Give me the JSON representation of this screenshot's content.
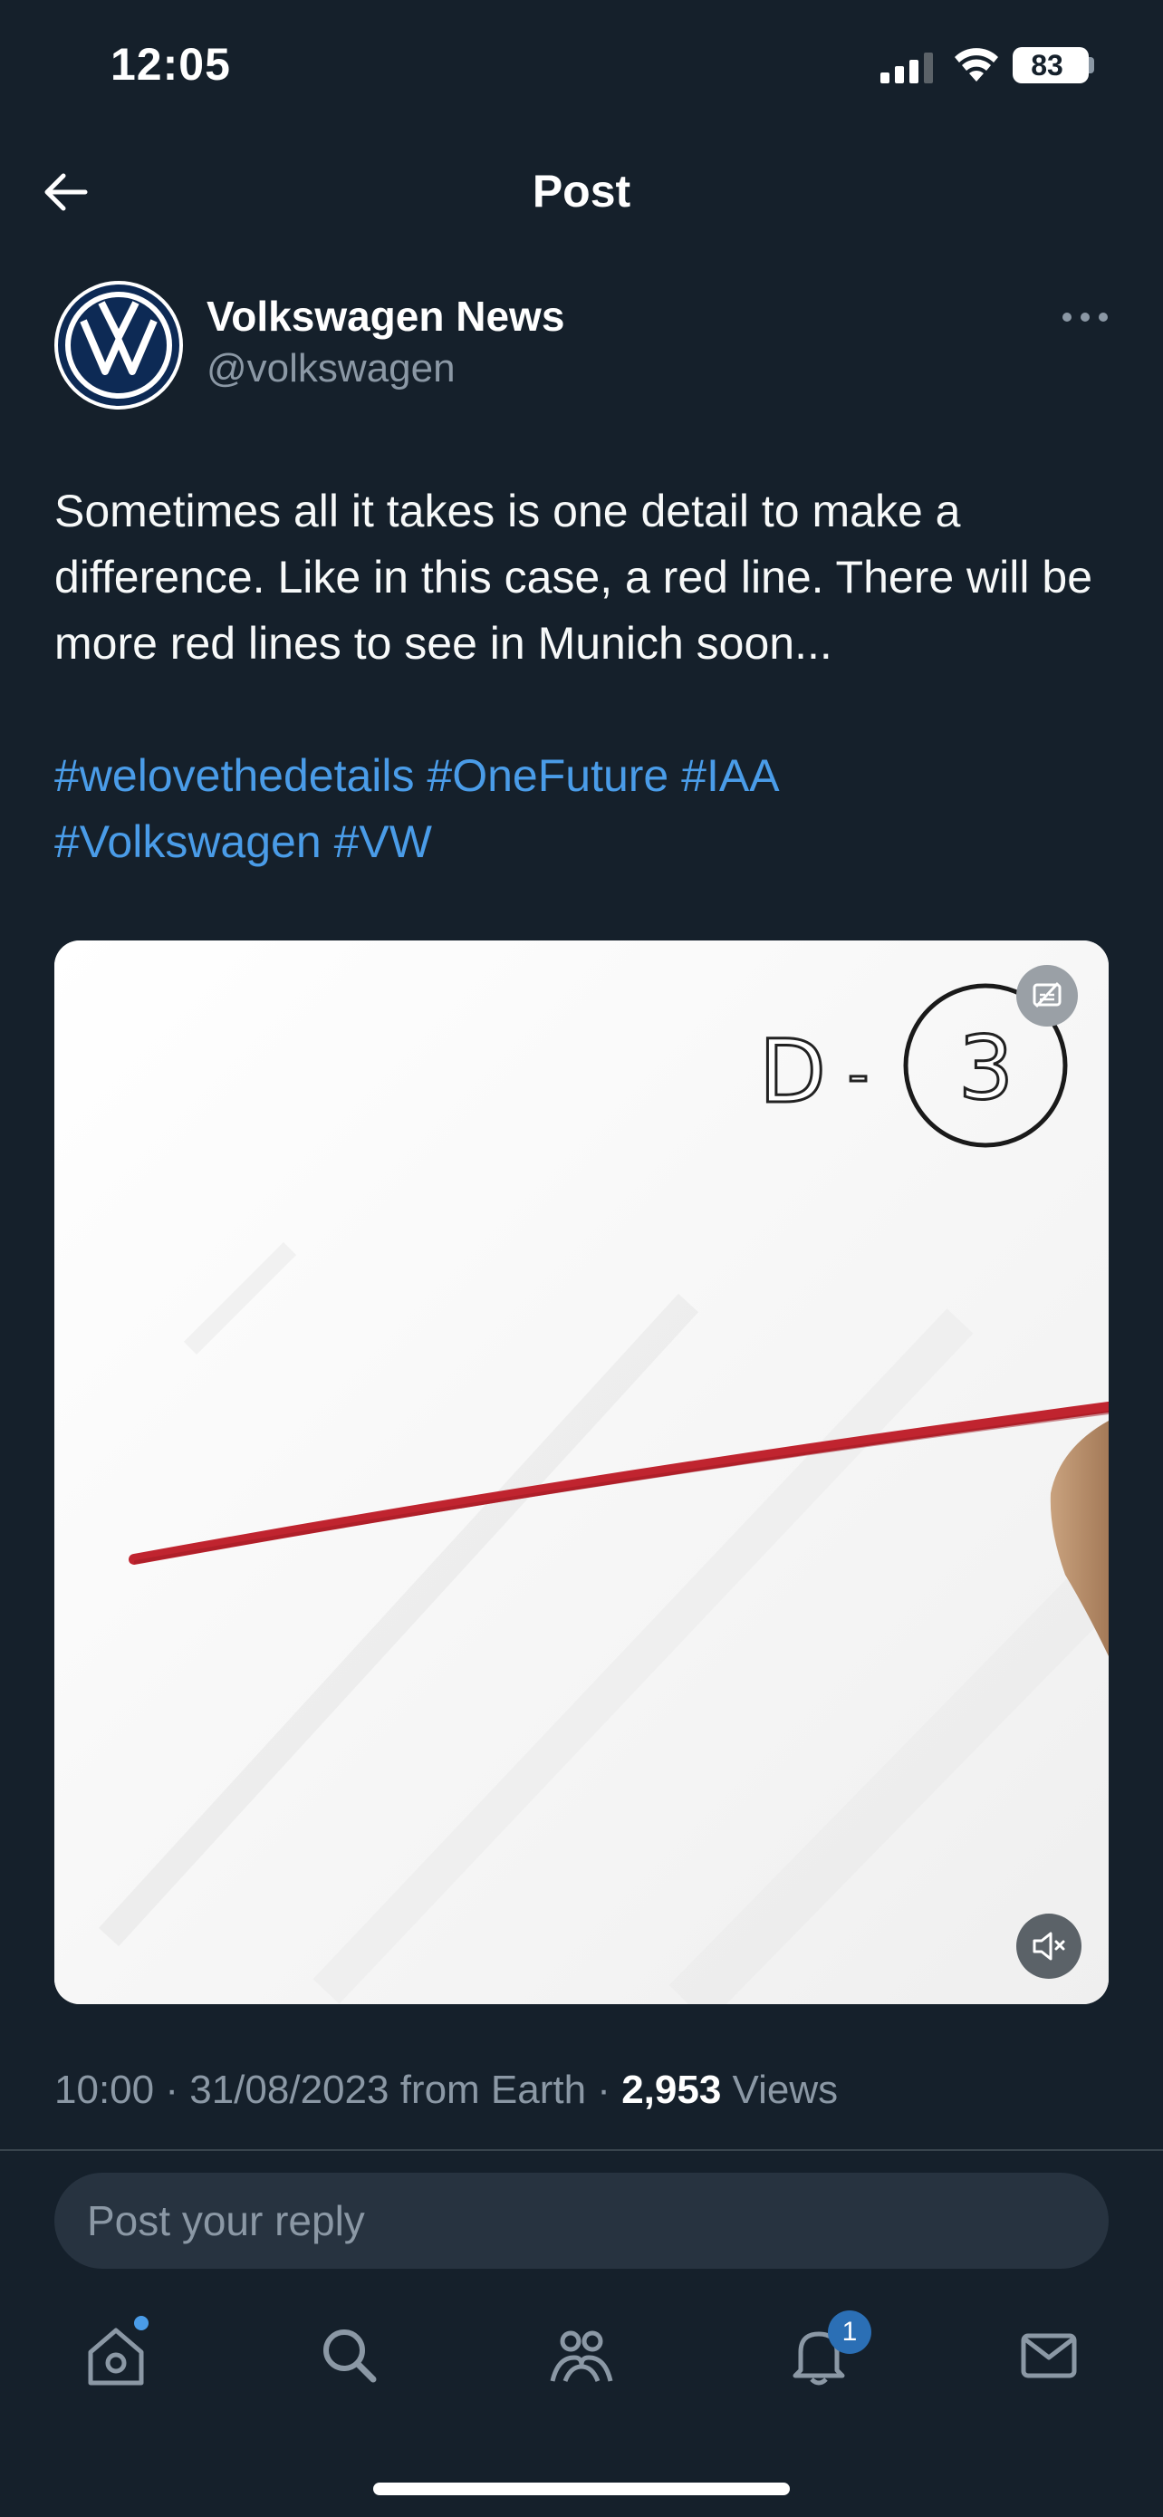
{
  "status_bar": {
    "time": "12:05",
    "battery": "83"
  },
  "header": {
    "title": "Post",
    "back_icon": "arrow-left-icon"
  },
  "author": {
    "name": "Volkswagen News",
    "handle": "@volkswagen",
    "avatar_icon": "vw-logo"
  },
  "post": {
    "text": "Sometimes all it takes is one detail to make a difference. Like in this case, a red line. There will be more red lines to see in Munich soon...",
    "hashtags": [
      "#welovethedetails",
      "#OneFuture",
      "#IAA",
      "#Volkswagen",
      "#VW"
    ]
  },
  "media": {
    "type": "video",
    "overlay_text_left": "D",
    "overlay_text_dash": "-",
    "overlay_text_number": "3",
    "captions_icon": "captions-icon",
    "mute_icon": "speaker-muted-icon"
  },
  "meta": {
    "time": "10:00",
    "date": "31/08/2023",
    "source": "from Earth",
    "views_count": "2,953",
    "views_label": "Views"
  },
  "reply": {
    "placeholder": "Post your reply"
  },
  "nav": {
    "items": [
      "home-icon",
      "search-icon",
      "communities-icon",
      "notifications-icon",
      "messages-icon"
    ],
    "notifications_badge": "1"
  },
  "colors": {
    "background": "#15202b",
    "accent": "#4a9ce8",
    "muted": "#8b98a5",
    "red_line": "#c0242f"
  }
}
